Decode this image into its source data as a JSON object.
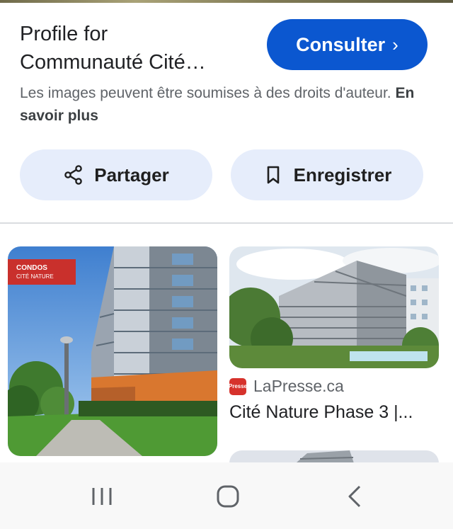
{
  "header": {
    "title_line1": "Profile for",
    "title_line2": "Communauté Cité…",
    "consult_label": "Consulter",
    "consult_chevron": "›",
    "notice_text": "Les images peuvent être soumises à des droits d'auteur.",
    "notice_link": "En savoir plus"
  },
  "actions": {
    "share_label": "Partager",
    "save_label": "Enregistrer"
  },
  "results": [
    {
      "image_overlay_line1": "CONDOS",
      "image_overlay_line2": "CITÉ NATURE"
    },
    {
      "source_icon_text": "Presse",
      "source_name": "LaPresse.ca",
      "title": "Cité Nature Phase 3 |..."
    }
  ],
  "nav": {
    "recents_icon": "recents-icon",
    "home_icon": "home-icon",
    "back_icon": "back-icon"
  },
  "colors": {
    "primary": "#0b57d0",
    "pill_bg": "#e6edfb",
    "source_red": "#d6322c"
  }
}
